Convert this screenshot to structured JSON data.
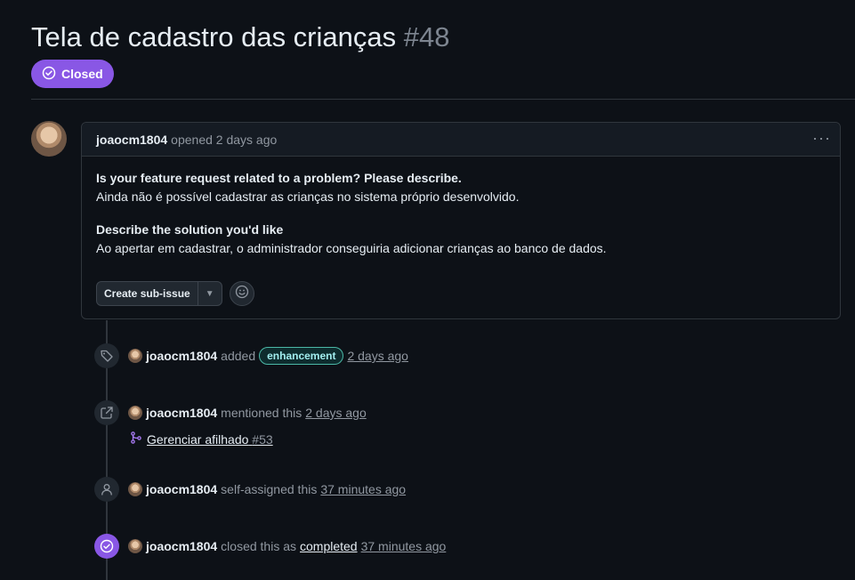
{
  "issue": {
    "title": "Tela de cadastro das crianças",
    "number": "#48",
    "state": "Closed"
  },
  "comment": {
    "author": "joaocm1804",
    "meta": "opened 2 days ago",
    "heading1": "Is your feature request related to a problem? Please describe.",
    "text1": "Ainda não é possível cadastrar as crianças no sistema próprio desenvolvido.",
    "heading2": "Describe the solution you'd like",
    "text2": "Ao apertar em cadastrar, o administrador conseguiria adicionar crianças ao banco de dados.",
    "create_sub_issue": "Create sub-issue"
  },
  "timeline": {
    "labeled": {
      "user": "joaocm1804",
      "action": "added",
      "label": "enhancement",
      "time": "2 days ago"
    },
    "mentioned": {
      "user": "joaocm1804",
      "action": "mentioned this",
      "time": "2 days ago",
      "ref_title": "Gerenciar afilhado",
      "ref_number": "#53"
    },
    "assigned": {
      "user": "joaocm1804",
      "action": "self-assigned this",
      "time": "37 minutes ago"
    },
    "closed": {
      "user": "joaocm1804",
      "action": "closed this as",
      "reason": "completed",
      "time": "37 minutes ago"
    }
  },
  "colors": {
    "closed_purple": "#8957e5",
    "label_text": "#a2eeef",
    "label_border": "#4bb7a6",
    "background": "#0d1117"
  }
}
